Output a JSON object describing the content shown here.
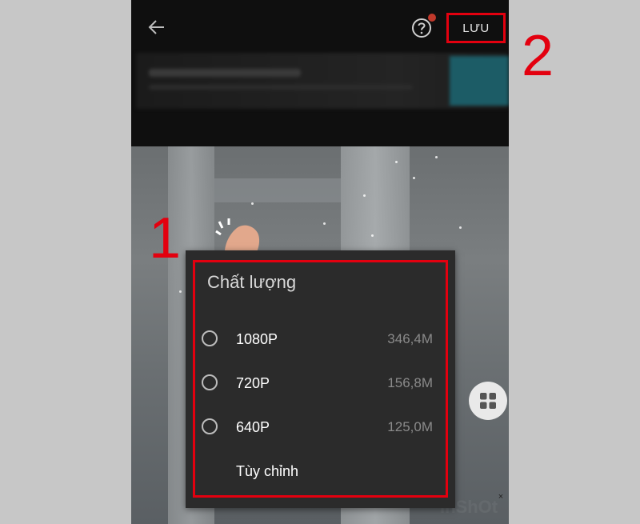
{
  "header": {
    "save_label": "LƯU"
  },
  "dialog": {
    "title": "Chất lượng",
    "options": [
      {
        "label": "1080P",
        "size": "346,4M"
      },
      {
        "label": "720P",
        "size": "156,8M"
      },
      {
        "label": "640P",
        "size": "125,0M"
      }
    ],
    "custom_label": "Tùy chỉnh"
  },
  "annotations": {
    "step1": "1",
    "step2": "2"
  },
  "preview": {
    "watermark": "InShOt",
    "close_glyph": "×"
  },
  "colors": {
    "highlight": "#e3000f",
    "dialog_bg": "#2b2b2b",
    "notification_dot": "#c0392b"
  },
  "icons": {
    "back": "arrow-left-icon",
    "help": "question-circle-icon",
    "grid": "grid-icon"
  }
}
